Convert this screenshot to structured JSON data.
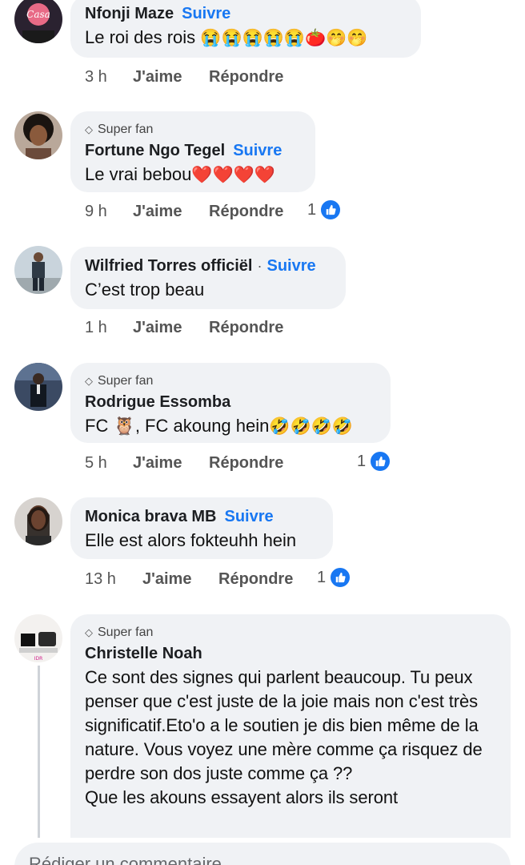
{
  "comments": [
    {
      "name": "Nfonji Maze",
      "separator": "",
      "follow": "Suivre",
      "superfan": false,
      "text": "Le roi des rois",
      "emoji": "😭😭😭😭😭🍅🤭🤭",
      "time": "3 h",
      "like": "J'aime",
      "reply": "Répondre",
      "reaction_count": ""
    },
    {
      "badge": "Super fan",
      "name": "Fortune Ngo Tegel",
      "separator": "",
      "follow": "Suivre",
      "superfan": true,
      "text": "Le vrai bebou",
      "emoji": "❤️❤️❤️❤️",
      "time": "9 h",
      "like": "J'aime",
      "reply": "Répondre",
      "reaction_count": "1"
    },
    {
      "name": "Wilfried Torres officiël",
      "separator": "·",
      "follow": "Suivre",
      "superfan": false,
      "text": "C’est trop beau",
      "emoji": "",
      "time": "1 h",
      "like": "J'aime",
      "reply": "Répondre",
      "reaction_count": ""
    },
    {
      "badge": "Super fan",
      "name": "Rodrigue Essomba",
      "separator": "",
      "follow": "",
      "superfan": true,
      "text": "FC 🦉, FC akoung hein",
      "emoji": "🤣🤣🤣🤣",
      "time": "5 h",
      "like": "J'aime",
      "reply": "Répondre",
      "reaction_count": "1"
    },
    {
      "name": "Monica brava MB",
      "separator": "",
      "follow": "Suivre",
      "superfan": false,
      "text": "Elle est alors fokteuhh hein",
      "emoji": "",
      "time": "13 h",
      "like": "J'aime",
      "reply": "Répondre",
      "reaction_count": "1"
    },
    {
      "badge": "Super fan",
      "name": "Christelle Noah",
      "separator": "",
      "follow": "",
      "superfan": true,
      "text": "Ce sont des signes qui parlent beaucoup. Tu peux penser que c'est juste de la joie mais non c'est très significatif.Eto'o a le soutien je dis bien même de la nature. Vous voyez une mère comme ça risquez de perdre son dos juste comme ça ??\nQue les akouns essayent alors ils seront",
      "emoji": "",
      "time": "",
      "like": "",
      "reply": "",
      "reaction_count": ""
    }
  ],
  "composer": {
    "placeholder": "Rédiger un commentaire..."
  },
  "colors": {
    "bubble": "#f0f2f5",
    "accent": "#1877f2",
    "meta": "#555555"
  },
  "icons": {
    "superfan": "diamond-icon",
    "like_reaction": "thumbs-up-icon"
  }
}
